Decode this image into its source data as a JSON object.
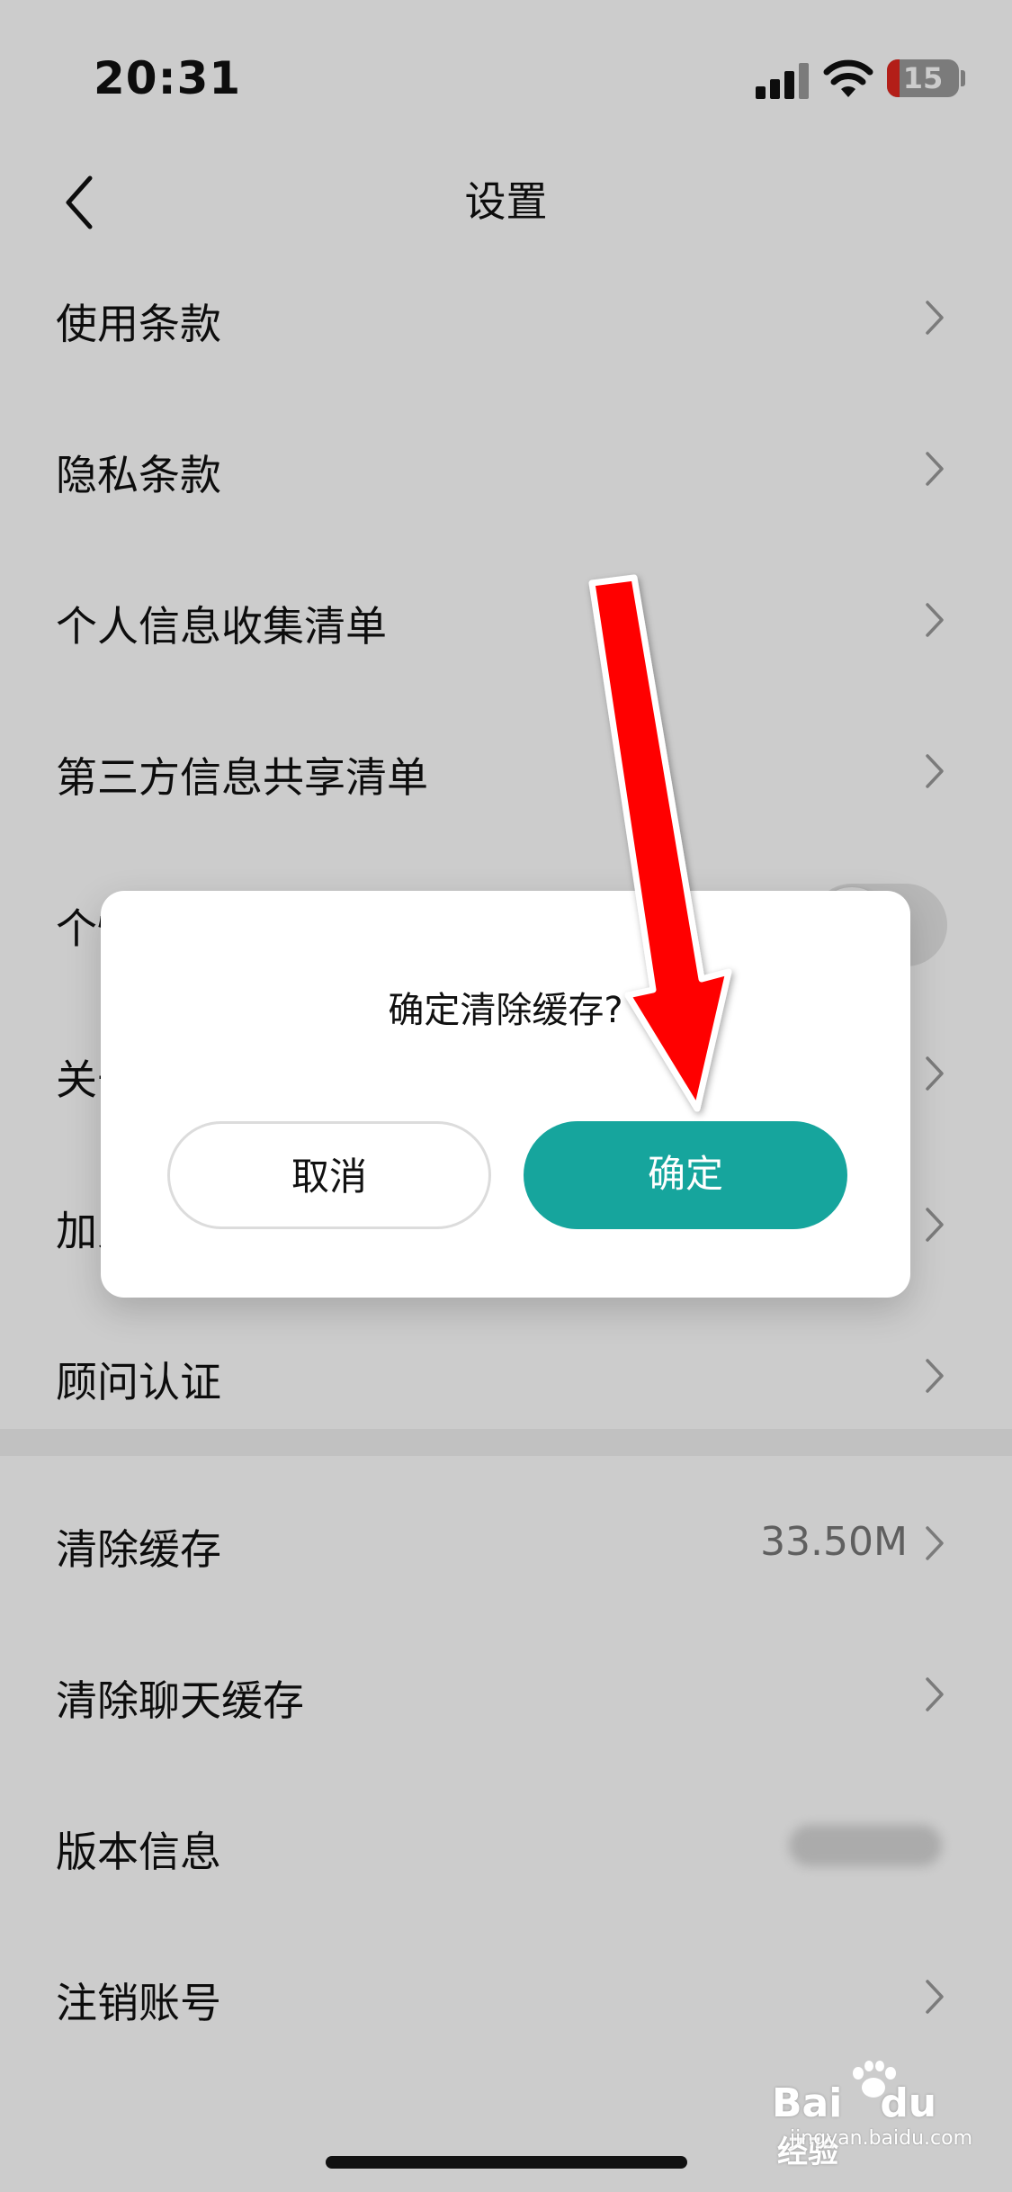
{
  "status_bar": {
    "time": "20:31",
    "battery_level": "15",
    "battery_low_color": "#e0261e"
  },
  "nav": {
    "title": "设置"
  },
  "settings": {
    "items": [
      {
        "label": "使用条款"
      },
      {
        "label": "隐私条款"
      },
      {
        "label": "个人信息收集清单"
      },
      {
        "label": "第三方信息共享清单"
      },
      {
        "label": "个性化推荐",
        "toggle_on": false
      },
      {
        "label": "关于我们"
      },
      {
        "label": "加入我们"
      },
      {
        "label": "顾问认证"
      },
      {
        "label": "清除缓存",
        "value": "33.50M"
      },
      {
        "label": "清除聊天缓存"
      },
      {
        "label": "版本信息"
      },
      {
        "label": "注销账号"
      }
    ]
  },
  "dialog": {
    "message": "确定清除缓存?",
    "cancel_label": "取消",
    "confirm_label": "确定",
    "confirm_color": "#16a59d"
  },
  "annotation": {
    "arrow_color": "#ff0000"
  },
  "watermark": {
    "logo": "Bai",
    "logo2": "du",
    "site": "jingyan.baidu.com",
    "suffix": "经验"
  }
}
